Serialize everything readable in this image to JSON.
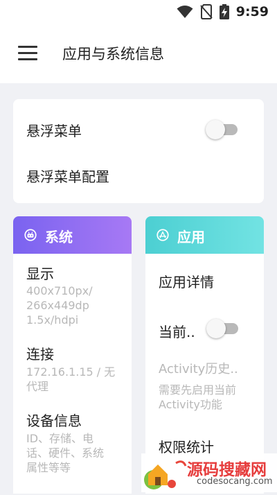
{
  "status_bar": {
    "time": "9:59",
    "icons": [
      "wifi-icon",
      "no-sim-icon",
      "battery-charging-icon"
    ]
  },
  "app_bar": {
    "title": "应用与系统信息",
    "menu_icon": "hamburger-menu-icon"
  },
  "top_card": {
    "floating_menu_label": "悬浮菜单",
    "floating_menu_enabled": false,
    "floating_menu_config_label": "悬浮菜单配置"
  },
  "system": {
    "title": "系统",
    "icon": "android-robot-icon",
    "display_title": "显示",
    "display_value_1": "400x710px/",
    "display_value_2": "266x449dp",
    "display_value_3": "1.5x/hdpi",
    "connection_title": "连接",
    "connection_value_1": "172.16.1.15 / 无",
    "connection_value_2": "代理",
    "device_title": "设备信息",
    "device_value_1": "ID、存储、电",
    "device_value_2": "话、硬件、系统",
    "device_value_3": "属性等等"
  },
  "app": {
    "title": "应用",
    "icon": "app-store-icon",
    "details_title": "应用详情",
    "current_label": "当前..",
    "current_enabled": false,
    "history_title": "Activity历史..",
    "history_hint_1": "需要先启用当前",
    "history_hint_2": "Activity功能",
    "permissions_title": "权限统计"
  },
  "watermark": {
    "brand": "源码搜藏网",
    "domain": "codesocang.com"
  },
  "colors": {
    "system_header_start": "#7a63f0",
    "system_header_end": "#a779f4",
    "app_header_start": "#4ccfd2",
    "app_header_end": "#72e3e3"
  }
}
